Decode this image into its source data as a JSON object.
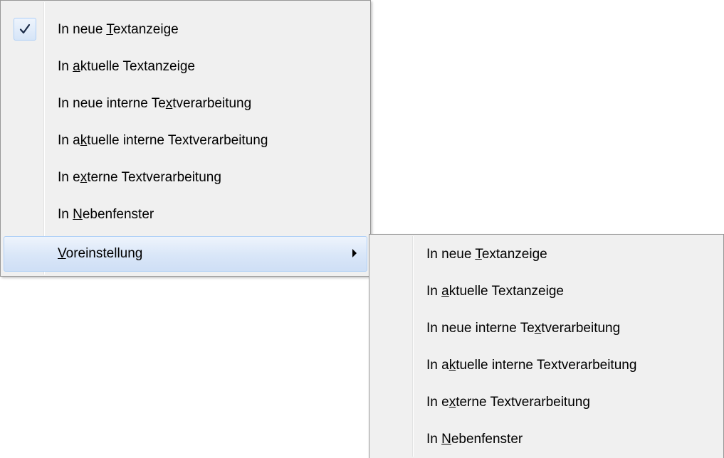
{
  "main_menu": {
    "items": [
      {
        "pre": "In neue ",
        "key": "T",
        "post": "extanzeige",
        "checked": true
      },
      {
        "pre": "In ",
        "key": "a",
        "post": "ktuelle Textanzeige"
      },
      {
        "pre": "In neue interne Te",
        "key": "x",
        "post": "tverarbeitung"
      },
      {
        "pre": "In a",
        "key": "k",
        "post": "tuelle interne Textverarbeitung"
      },
      {
        "pre": "In e",
        "key": "x",
        "post": "terne Textverarbeitung"
      },
      {
        "pre": "In ",
        "key": "N",
        "post": "ebenfenster"
      },
      {
        "pre": "",
        "key": "V",
        "post": "oreinstellung",
        "submenu": true,
        "highlighted": true
      }
    ]
  },
  "sub_menu": {
    "items": [
      {
        "pre": "In neue ",
        "key": "T",
        "post": "extanzeige"
      },
      {
        "pre": "In ",
        "key": "a",
        "post": "ktuelle Textanzeige"
      },
      {
        "pre": "In neue interne Te",
        "key": "x",
        "post": "tverarbeitung"
      },
      {
        "pre": "In a",
        "key": "k",
        "post": "tuelle interne Textverarbeitung"
      },
      {
        "pre": "In e",
        "key": "x",
        "post": "terne Textverarbeitung"
      },
      {
        "pre": "In ",
        "key": "N",
        "post": "ebenfenster"
      }
    ]
  },
  "icons": {
    "checkmark": "checkmark-icon",
    "submenu_arrow": "submenu-arrow-icon"
  },
  "colors": {
    "menu_background": "#f0f0f0",
    "menu_border": "#979797",
    "highlight_border": "#aecff7",
    "text": "#000000"
  }
}
